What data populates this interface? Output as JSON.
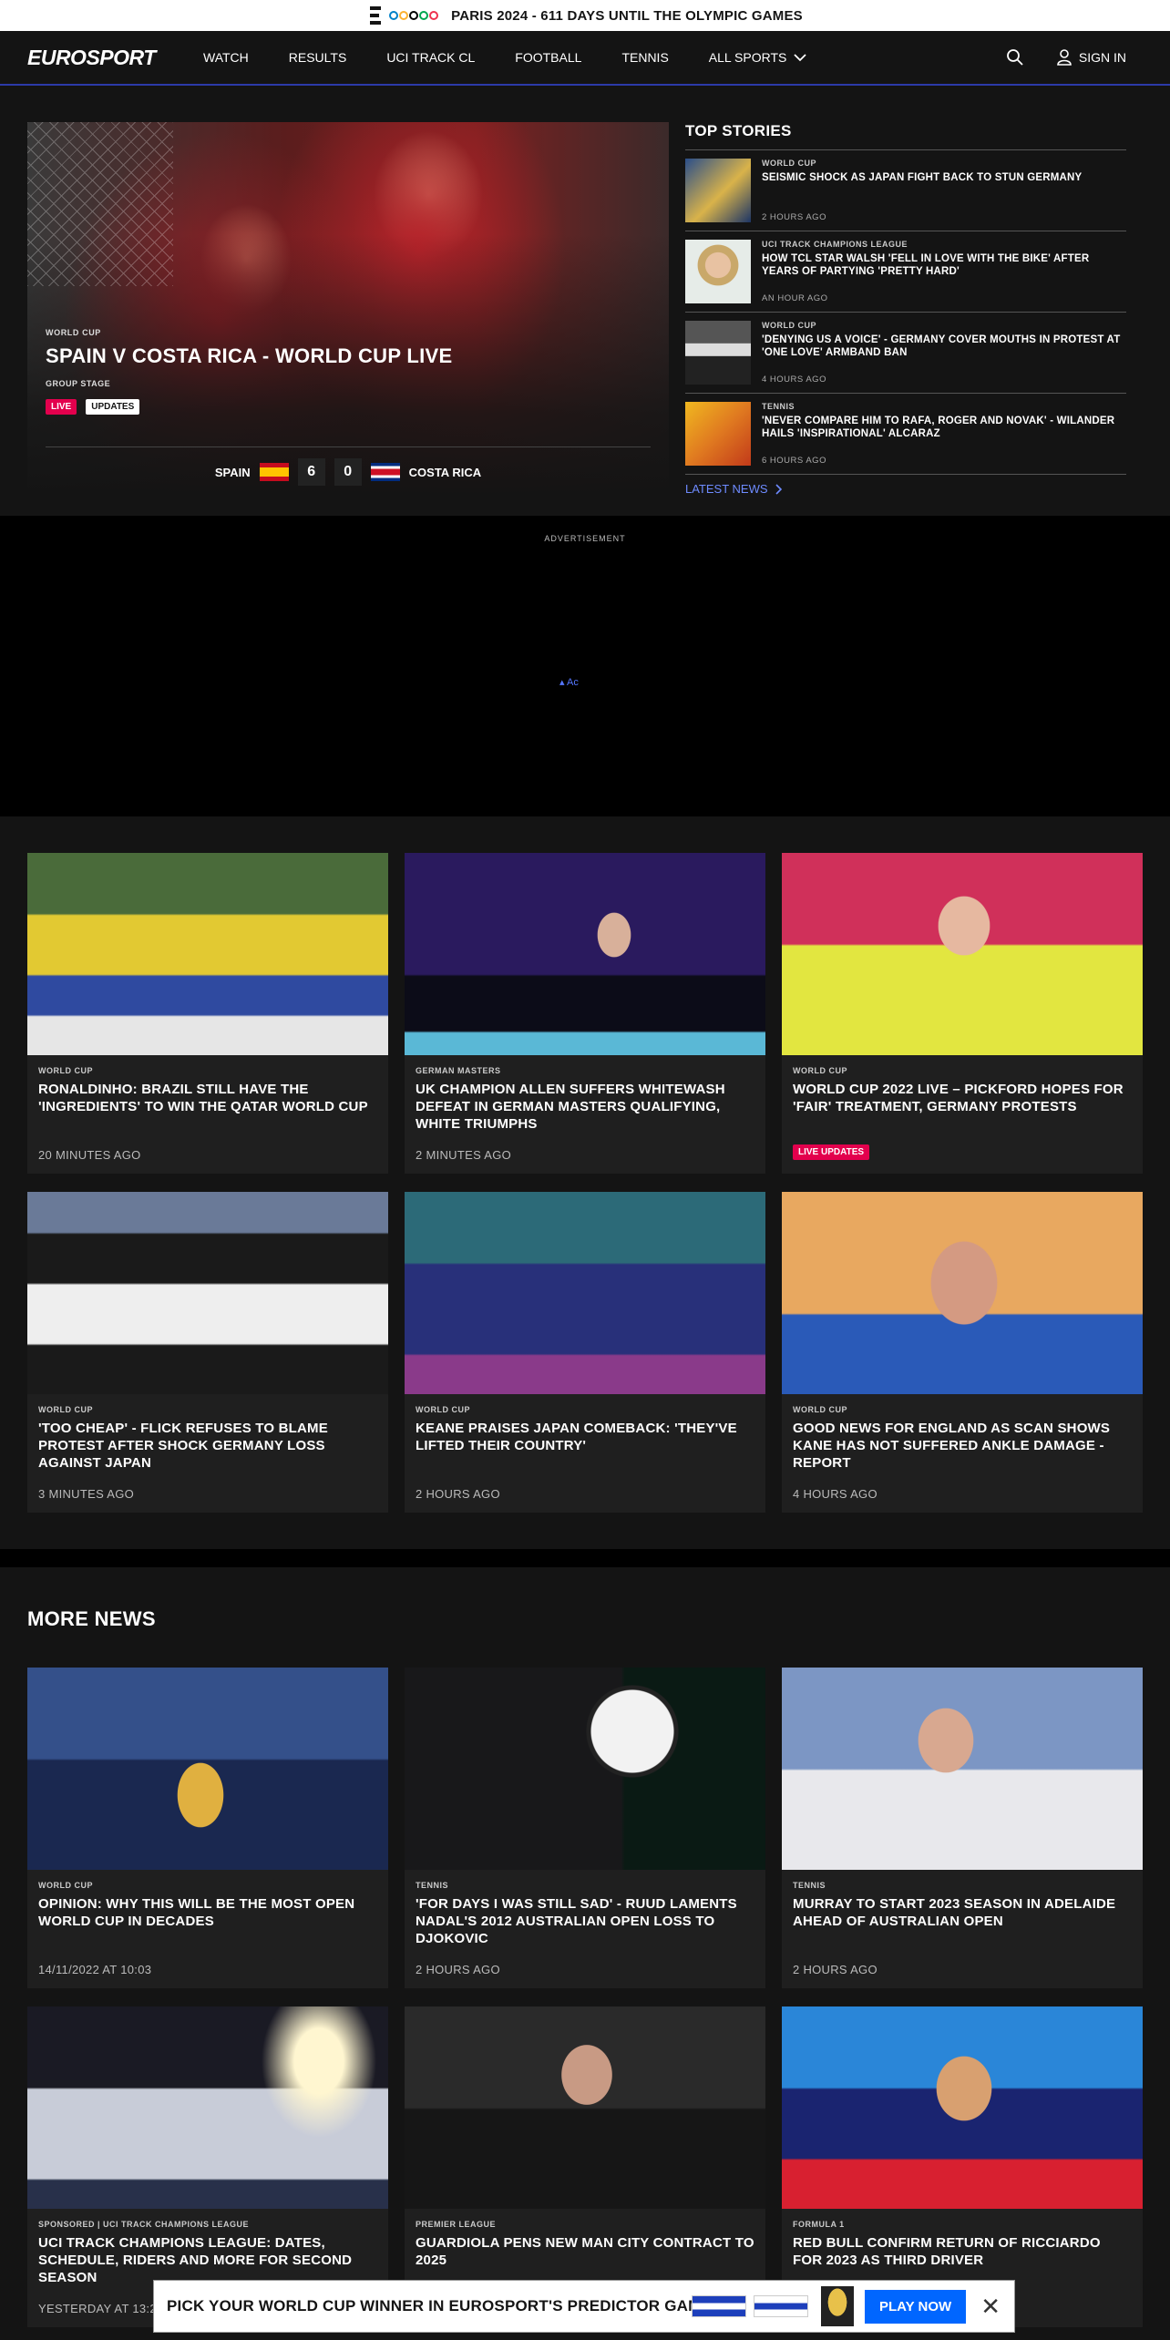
{
  "topbar": {
    "text": "PARIS 2024 - 611 DAYS UNTIL THE OLYMPIC GAMES",
    "ring_colors": [
      "#0081c8",
      "#fcb131",
      "#000000",
      "#00a651",
      "#ee334e"
    ]
  },
  "nav": {
    "logo": "EUROSPORT",
    "items": [
      "WATCH",
      "RESULTS",
      "UCI TRACK CL",
      "FOOTBALL",
      "TENNIS",
      "ALL SPORTS"
    ],
    "signin": "SIGN IN",
    "icons": [
      "search-icon",
      "user-icon",
      "chevron-down-icon"
    ]
  },
  "hero": {
    "kicker": "WORLD CUP",
    "title": "SPAIN V COSTA RICA - WORLD CUP LIVE",
    "subtitle": "GROUP STAGE",
    "tags": {
      "live": "LIVE",
      "updates": "UPDATES"
    },
    "score": {
      "home": "SPAIN",
      "home_score": "6",
      "away_score": "0",
      "away": "COSTA RICA"
    }
  },
  "top_stories": {
    "title": "TOP STORIES",
    "items": [
      {
        "kicker": "WORLD CUP",
        "title": "SEISMIC SHOCK AS JAPAN FIGHT BACK TO STUN GERMANY",
        "time": "2 HOURS AGO"
      },
      {
        "kicker": "UCI TRACK CHAMPIONS LEAGUE",
        "title": "HOW TCL STAR WALSH 'FELL IN LOVE WITH THE BIKE' AFTER YEARS OF PARTYING 'PRETTY HARD'",
        "time": "AN HOUR AGO"
      },
      {
        "kicker": "WORLD CUP",
        "title": "'DENYING US A VOICE' - GERMANY COVER MOUTHS IN PROTEST AT 'ONE LOVE' ARMBAND BAN",
        "time": "4 HOURS AGO"
      },
      {
        "kicker": "TENNIS",
        "title": "'NEVER COMPARE HIM TO RAFA, ROGER AND NOVAK' - WILANDER HAILS 'INSPIRATIONAL' ALCARAZ",
        "time": "6 HOURS AGO"
      }
    ],
    "latest": "LATEST NEWS"
  },
  "ad": {
    "label": "ADVERTISEMENT",
    "mark": "Ac"
  },
  "grid": [
    {
      "kicker": "WORLD CUP",
      "title": "RONALDINHO: BRAZIL STILL HAVE THE 'INGREDIENTS' TO WIN THE QATAR WORLD CUP",
      "time": "20 MINUTES AGO"
    },
    {
      "kicker": "GERMAN MASTERS",
      "title": "UK CHAMPION ALLEN SUFFERS WHITEWASH DEFEAT IN GERMAN MASTERS QUALIFYING, WHITE TRIUMPHS",
      "time": "2 MINUTES AGO"
    },
    {
      "kicker": "WORLD CUP",
      "title": "WORLD CUP 2022 LIVE – PICKFORD HOPES FOR 'FAIR' TREATMENT, GERMANY PROTESTS",
      "live": "LIVE UPDATES"
    },
    {
      "kicker": "WORLD CUP",
      "title": "'TOO CHEAP' - FLICK REFUSES TO BLAME PROTEST AFTER SHOCK GERMANY LOSS AGAINST JAPAN",
      "time": "3 MINUTES AGO"
    },
    {
      "kicker": "WORLD CUP",
      "title": "KEANE PRAISES JAPAN COMEBACK: 'THEY'VE LIFTED THEIR COUNTRY'",
      "time": "2 HOURS AGO"
    },
    {
      "kicker": "WORLD CUP",
      "title": "GOOD NEWS FOR ENGLAND AS SCAN SHOWS KANE HAS NOT SUFFERED ANKLE DAMAGE - REPORT",
      "time": "4 HOURS AGO"
    }
  ],
  "more_news": {
    "title": "MORE NEWS",
    "items": [
      {
        "kicker": "WORLD CUP",
        "title": "OPINION: WHY THIS WILL BE THE MOST OPEN WORLD CUP IN DECADES",
        "time": "14/11/2022 AT 10:03"
      },
      {
        "kicker": "TENNIS",
        "title": "'FOR DAYS I WAS STILL SAD' - RUUD LAMENTS NADAL'S 2012 AUSTRALIAN OPEN LOSS TO DJOKOVIC",
        "time": "2 HOURS AGO"
      },
      {
        "kicker": "TENNIS",
        "title": "MURRAY TO START 2023 SEASON IN ADELAIDE AHEAD OF AUSTRALIAN OPEN",
        "time": "2 HOURS AGO"
      },
      {
        "kicker": "SPONSORED | UCI TRACK CHAMPIONS LEAGUE",
        "title": "UCI TRACK CHAMPIONS LEAGUE: DATES, SCHEDULE, RIDERS AND MORE FOR SECOND SEASON",
        "time": "YESTERDAY AT 13:2"
      },
      {
        "kicker": "PREMIER LEAGUE",
        "title": "GUARDIOLA PENS NEW MAN CITY CONTRACT TO 2025",
        "time": ""
      },
      {
        "kicker": "FORMULA 1",
        "title": "RED BULL CONFIRM RETURN OF RICCIARDO FOR 2023 AS THIRD DRIVER",
        "time": ""
      }
    ]
  },
  "sticky": {
    "text": "PICK YOUR WORLD CUP WINNER IN EUROSPORT'S PREDICTOR GAME",
    "cta": "PLAY NOW"
  },
  "colors": {
    "accent": "#2c3aa8",
    "live": "#e3004d",
    "link": "#6e8bff",
    "cta": "#0066ff"
  }
}
